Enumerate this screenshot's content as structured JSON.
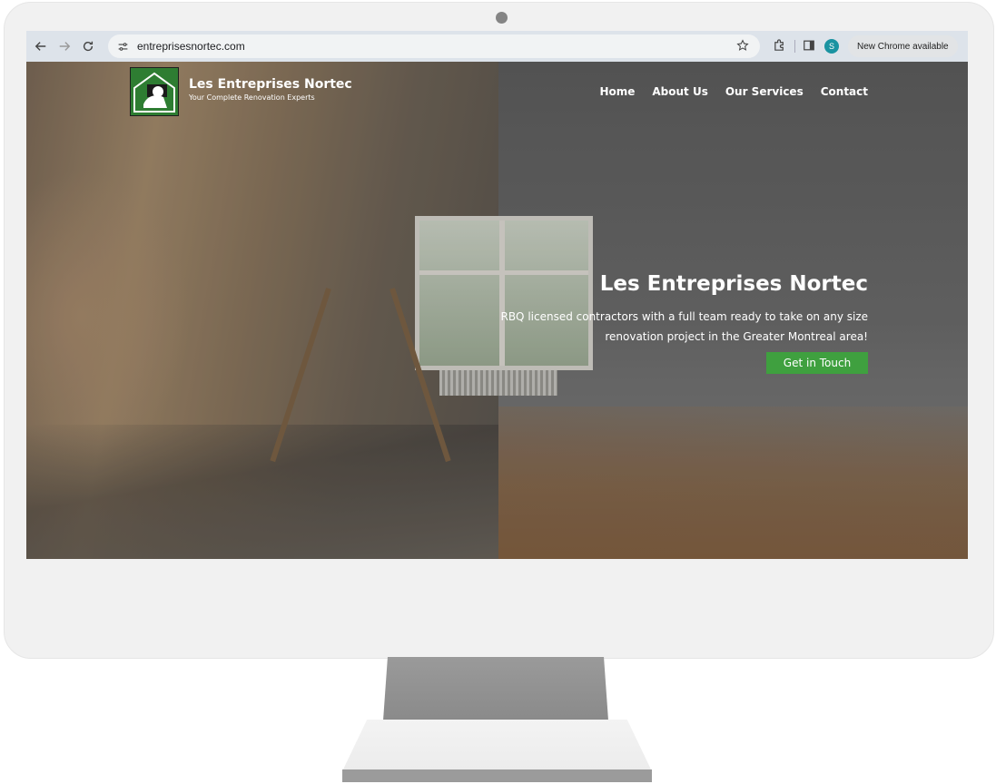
{
  "browser": {
    "url": "entreprisesnortec.com",
    "new_chrome_label": "New Chrome available",
    "profile_initial": "S"
  },
  "site": {
    "name": "Les Entreprises Nortec",
    "tagline": "Your Complete Renovation Experts"
  },
  "nav": {
    "items": [
      "Home",
      "About Us",
      "Our Services",
      "Contact"
    ]
  },
  "hero": {
    "title": "Les Entreprises Nortec",
    "description_line1": "RBQ licensed contractors with a full team ready to take on any size",
    "description_line2": "renovation project in the Greater Montreal area!",
    "cta_label": "Get in Touch"
  },
  "colors": {
    "cta": "#3fa03f",
    "logo_green": "#2e7d32",
    "toolbar": "#dde3ea"
  }
}
